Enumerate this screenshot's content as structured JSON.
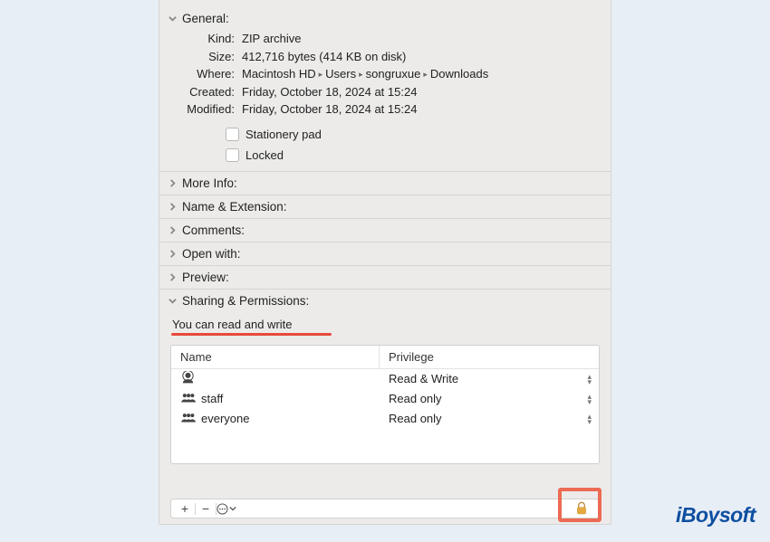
{
  "sections": {
    "general": "General:",
    "moreInfo": "More Info:",
    "nameExt": "Name & Extension:",
    "comments": "Comments:",
    "openWith": "Open with:",
    "preview": "Preview:",
    "sharing": "Sharing & Permissions:"
  },
  "general": {
    "labels": {
      "kind": "Kind:",
      "size": "Size:",
      "where": "Where:",
      "created": "Created:",
      "modified": "Modified:"
    },
    "kind": "ZIP archive",
    "size": "412,716 bytes (414 KB on disk)",
    "whereParts": [
      "Macintosh HD",
      "Users",
      "songruxue",
      "Downloads"
    ],
    "created": "Friday, October 18, 2024 at 15:24",
    "modified": "Friday, October 18, 2024 at 15:24",
    "stationery": "Stationery pad",
    "locked": "Locked"
  },
  "permissions": {
    "summary": "You can read and write",
    "headers": {
      "name": "Name",
      "privilege": "Privilege"
    },
    "rows": [
      {
        "iconType": "user",
        "name": "",
        "privilege": "Read & Write"
      },
      {
        "iconType": "group",
        "name": "staff",
        "privilege": "Read only"
      },
      {
        "iconType": "group",
        "name": "everyone",
        "privilege": "Read only"
      }
    ]
  },
  "toolbar": {
    "add": "+",
    "remove": "−",
    "more": "⊙"
  },
  "brand": "iBoysoft"
}
